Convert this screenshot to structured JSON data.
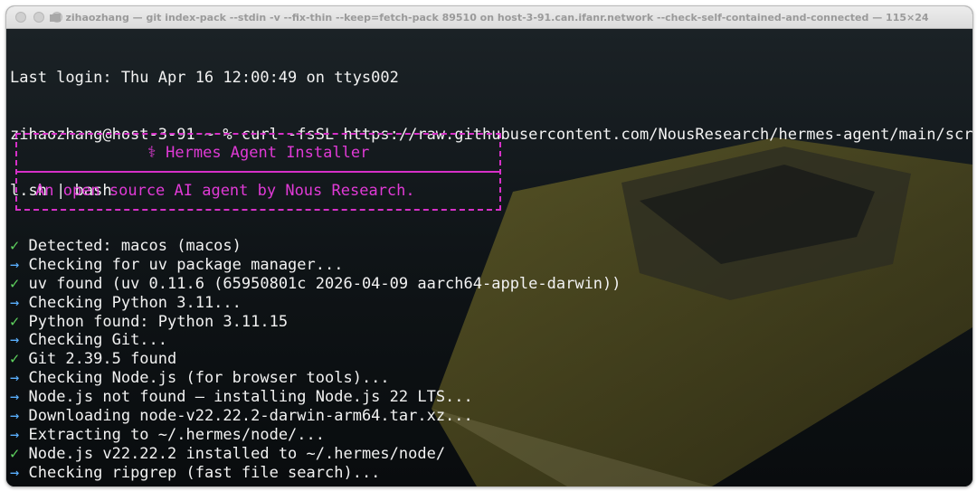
{
  "window": {
    "title": "zihaozhang — git index-pack --stdin -v --fix-thin --keep=fetch-pack 89510 on host-3-91.can.ifanr.network --check-self-contained-and-connected — 115×24"
  },
  "terminal": {
    "last_login": "Last login: Thu Apr 16 12:00:49 on ttys002",
    "command_line_1": "zihaozhang@host-3-91 ~ % curl -fsSL https://raw.githubusercontent.com/NousResearch/hermes-agent/main/scripts/instal",
    "command_line_2": "l.sh | bash",
    "banner": {
      "title": "⚕ Hermes Agent Installer",
      "subtitle": "An open source AI agent by Nous Research."
    },
    "output": [
      {
        "mark": "✓",
        "type": "ok",
        "text": "Detected: macos (macos)"
      },
      {
        "mark": "→",
        "type": "info",
        "text": "Checking for uv package manager..."
      },
      {
        "mark": "✓",
        "type": "ok",
        "text": "uv found (uv 0.11.6 (65950801c 2026-04-09 aarch64-apple-darwin))"
      },
      {
        "mark": "→",
        "type": "info",
        "text": "Checking Python 3.11..."
      },
      {
        "mark": "✓",
        "type": "ok",
        "text": "Python found: Python 3.11.15"
      },
      {
        "mark": "→",
        "type": "info",
        "text": "Checking Git..."
      },
      {
        "mark": "✓",
        "type": "ok",
        "text": "Git 2.39.5 found"
      },
      {
        "mark": "→",
        "type": "info",
        "text": "Checking Node.js (for browser tools)..."
      },
      {
        "mark": "→",
        "type": "info",
        "text": "Node.js not found — installing Node.js 22 LTS..."
      },
      {
        "mark": "→",
        "type": "info",
        "text": "Downloading node-v22.22.2-darwin-arm64.tar.xz..."
      },
      {
        "mark": "→",
        "type": "info",
        "text": "Extracting to ~/.hermes/node/..."
      },
      {
        "mark": "✓",
        "type": "ok",
        "text": "Node.js v22.22.2 installed to ~/.hermes/node/"
      },
      {
        "mark": "→",
        "type": "info",
        "text": "Checking ripgrep (fast file search)..."
      }
    ]
  },
  "colors": {
    "ok": "#5fd35f",
    "info": "#5ab0ff",
    "banner": "#e03ad6"
  }
}
